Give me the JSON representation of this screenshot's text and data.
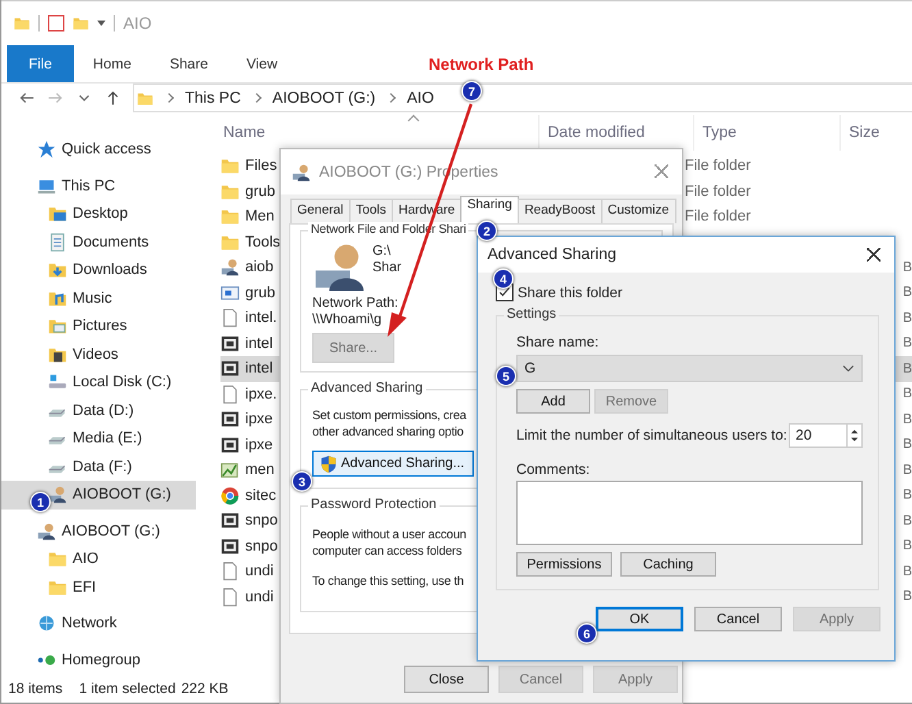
{
  "titlebar": {
    "title": "AIO"
  },
  "ribbon_tabs": [
    {
      "label": "File",
      "selected": true
    },
    {
      "label": "Home",
      "selected": false
    },
    {
      "label": "Share",
      "selected": false
    },
    {
      "label": "View",
      "selected": false
    }
  ],
  "address": {
    "crumbs": [
      "This PC",
      "AIOBOOT (G:)",
      "AIO"
    ]
  },
  "sidebar": {
    "items": [
      {
        "label": "Quick access",
        "kind": "star",
        "selected": false
      },
      {
        "label": "This PC",
        "kind": "pc",
        "selected": false,
        "children": [
          {
            "label": "Desktop",
            "kind": "desktop",
            "selected": false
          },
          {
            "label": "Documents",
            "kind": "documents",
            "selected": false
          },
          {
            "label": "Downloads",
            "kind": "downloads",
            "selected": false
          },
          {
            "label": "Music",
            "kind": "music",
            "selected": false
          },
          {
            "label": "Pictures",
            "kind": "pictures",
            "selected": false
          },
          {
            "label": "Videos",
            "kind": "videos",
            "selected": false
          },
          {
            "label": "Local Disk (C:)",
            "kind": "system",
            "selected": false
          },
          {
            "label": "Data (D:)",
            "kind": "drive",
            "selected": false
          },
          {
            "label": "Media (E:)",
            "kind": "drive",
            "selected": false
          },
          {
            "label": "Data (F:)",
            "kind": "drive",
            "selected": false
          },
          {
            "label": "AIOBOOT (G:)",
            "kind": "person",
            "selected": true
          }
        ]
      },
      {
        "label": "AIOBOOT (G:)",
        "kind": "person",
        "selected": false,
        "children": [
          {
            "label": "AIO",
            "kind": "folder",
            "selected": false
          },
          {
            "label": "EFI",
            "kind": "folder",
            "selected": false
          }
        ]
      },
      {
        "label": "Network",
        "kind": "network",
        "selected": false
      },
      {
        "label": "Homegroup",
        "kind": "homegroup",
        "selected": false
      }
    ]
  },
  "file_list": {
    "columns": [
      "Name",
      "Date modified",
      "Type",
      "Size"
    ],
    "rows": [
      {
        "kind": "folder",
        "name": "Files",
        "type": "File folder",
        "selected": false
      },
      {
        "kind": "folder",
        "name": "grub",
        "type": "File folder",
        "selected": false
      },
      {
        "kind": "folder",
        "name": "Men",
        "type": "File folder",
        "selected": false
      },
      {
        "kind": "folder",
        "name": "Tools",
        "selected": false
      },
      {
        "kind": "person",
        "name": "aiob",
        "size": "B",
        "selected": false
      },
      {
        "kind": "image",
        "name": "grub",
        "size": "B",
        "selected": false
      },
      {
        "kind": "file",
        "name": "intel.",
        "size": "B",
        "selected": false
      },
      {
        "kind": "archive",
        "name": "intel",
        "size": "B",
        "selected": false
      },
      {
        "kind": "archive",
        "name": "intel",
        "size": "B",
        "selected": true
      },
      {
        "kind": "file",
        "name": "ipxe.",
        "size": "B",
        "selected": false
      },
      {
        "kind": "archive",
        "name": "ipxe",
        "size": "B",
        "selected": false
      },
      {
        "kind": "archive",
        "name": "ipxe",
        "size": "B",
        "selected": false
      },
      {
        "kind": "picture",
        "name": "men",
        "size": "B",
        "selected": false
      },
      {
        "kind": "web",
        "name": "sitec",
        "size": "B",
        "selected": false
      },
      {
        "kind": "archive",
        "name": "snpo",
        "size": "B",
        "selected": false
      },
      {
        "kind": "archive",
        "name": "snpo",
        "size": "B",
        "selected": false
      },
      {
        "kind": "file",
        "name": "undi",
        "size": "B",
        "selected": false
      },
      {
        "kind": "file",
        "name": "undi",
        "size": "B",
        "selected": false
      }
    ]
  },
  "status_bar": {
    "count": "18 items",
    "selection": "1 item selected",
    "size": "222 KB"
  },
  "properties_dialog": {
    "title": "AIOBOOT (G:) Properties",
    "tabs": [
      {
        "label": "General",
        "selected": false
      },
      {
        "label": "Tools",
        "selected": false
      },
      {
        "label": "Hardware",
        "selected": false
      },
      {
        "label": "Sharing",
        "selected": true
      },
      {
        "label": "ReadyBoost",
        "selected": false
      },
      {
        "label": "Customize",
        "selected": false
      }
    ],
    "network_group": {
      "legend": "Network File and Folder Shari",
      "drive": "G:\\",
      "status": "Shar",
      "path_label": "Network Path:",
      "path": "\\\\Whoami\\g",
      "share_button": {
        "label": "Share...",
        "disabled": true
      }
    },
    "advanced_group": {
      "legend": "Advanced Sharing",
      "lines": [
        "Set custom permissions, crea",
        "other advanced sharing optio"
      ],
      "button": {
        "label": "Advanced Sharing...",
        "disabled": false
      }
    },
    "password_group": {
      "legend": "Password Protection",
      "lines": [
        "People without a user accoun",
        "computer can access folders"
      ],
      "note": "To change this setting, use th"
    },
    "buttons": [
      {
        "label": "Close",
        "disabled": false
      },
      {
        "label": "Cancel",
        "disabled": true
      },
      {
        "label": "Apply",
        "disabled": true
      }
    ]
  },
  "advanced_sharing_dialog": {
    "title": "Advanced Sharing",
    "share_folder": {
      "label": "Share this folder",
      "checked": true
    },
    "settings_legend": "Settings",
    "share_name_label": "Share name:",
    "share_name": "G",
    "name_buttons": [
      {
        "label": "Add",
        "disabled": false
      },
      {
        "label": "Remove",
        "disabled": true
      }
    ],
    "limit_label": "Limit the number of simultaneous users to:",
    "limit_value": "20",
    "comments_label": "Comments:",
    "option_buttons": [
      {
        "label": "Permissions",
        "disabled": false
      },
      {
        "label": "Caching",
        "disabled": false
      }
    ],
    "buttons": [
      {
        "label": "OK",
        "disabled": false,
        "default": true
      },
      {
        "label": "Cancel",
        "disabled": false,
        "default": false
      },
      {
        "label": "Apply",
        "disabled": true,
        "default": false
      }
    ]
  },
  "annotations": {
    "title": "Network Path",
    "markers": [
      "1",
      "2",
      "3",
      "4",
      "5",
      "6",
      "7"
    ]
  }
}
